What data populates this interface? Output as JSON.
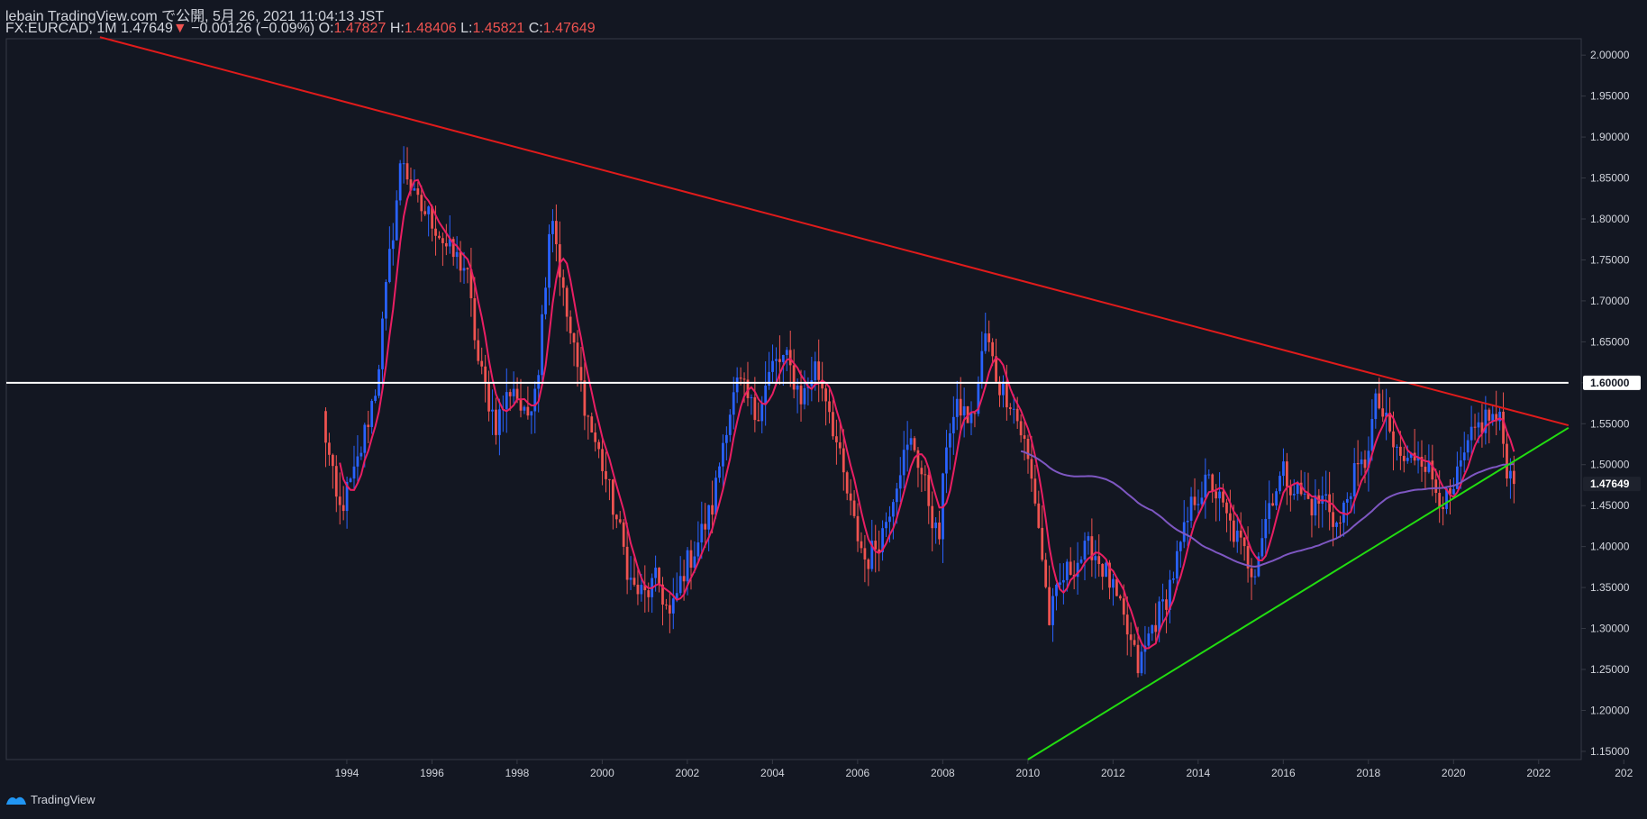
{
  "header": {
    "line1": "lebain TradingView.com で公開, 5月 26, 2021 11:04:13 JST",
    "symbol": "FX:EURCAD, 1M",
    "last": "1.47649",
    "change_arrow": "▼",
    "change": "−0.00126 (−0.09%)",
    "o_label": "O:",
    "o_val": "1.47827",
    "h_label": "H:",
    "h_val": "1.48406",
    "l_label": "L:",
    "l_val": "1.45821",
    "c_label": "C:",
    "c_val": "1.47649"
  },
  "footer": {
    "brand": "TradingView",
    "icon": "tradingview-logo-icon"
  },
  "colors": {
    "background": "#131722",
    "up": "#2962ff",
    "down": "#ef5350",
    "ma_fast": "#e91e63",
    "ma_slow": "#7e57c2",
    "resistance": "#e01b1b",
    "support": "#22dd11",
    "level": "#ffffff",
    "axis_text": "#d1d4dc"
  },
  "chart_data": {
    "type": "candlestick",
    "symbol": "FX:EURCAD",
    "interval": "1M",
    "xlabel": "",
    "ylabel": "",
    "ylim": [
      1.14,
      2.02
    ],
    "xlim": [
      1986.0,
      2023.0
    ],
    "x_ticks": [
      "1994",
      "1996",
      "1998",
      "2000",
      "2002",
      "2004",
      "2006",
      "2008",
      "2010",
      "2012",
      "2014",
      "2016",
      "2018",
      "2020",
      "2022",
      "202"
    ],
    "y_ticks": [
      "2.00000",
      "1.95000",
      "1.90000",
      "1.85000",
      "1.80000",
      "1.75000",
      "1.70000",
      "1.65000",
      "1.60000",
      "1.55000",
      "1.50000",
      "1.45000",
      "1.40000",
      "1.35000",
      "1.30000",
      "1.25000",
      "1.20000",
      "1.15000"
    ],
    "price_labels": [
      {
        "value": 1.6,
        "text": "1.60000",
        "style": "level"
      },
      {
        "value": 1.47649,
        "text": "1.47649",
        "style": "last"
      }
    ],
    "anchors": [
      [
        1993.42,
        1.56
      ],
      [
        1993.8,
        1.44
      ],
      [
        1994.2,
        1.49
      ],
      [
        1994.7,
        1.6
      ],
      [
        1995.0,
        1.75
      ],
      [
        1995.3,
        1.88
      ],
      [
        1995.6,
        1.82
      ],
      [
        1996.0,
        1.8
      ],
      [
        1996.4,
        1.76
      ],
      [
        1996.8,
        1.74
      ],
      [
        1997.1,
        1.62
      ],
      [
        1997.5,
        1.55
      ],
      [
        1997.9,
        1.6
      ],
      [
        1998.2,
        1.55
      ],
      [
        1998.5,
        1.62
      ],
      [
        1998.8,
        1.82
      ],
      [
        1999.1,
        1.7
      ],
      [
        1999.4,
        1.62
      ],
      [
        1999.7,
        1.55
      ],
      [
        2000.0,
        1.5
      ],
      [
        2000.4,
        1.42
      ],
      [
        2000.7,
        1.35
      ],
      [
        2001.0,
        1.34
      ],
      [
        2001.3,
        1.36
      ],
      [
        2001.6,
        1.31
      ],
      [
        2001.9,
        1.37
      ],
      [
        2002.2,
        1.4
      ],
      [
        2002.6,
        1.45
      ],
      [
        2002.9,
        1.55
      ],
      [
        2003.2,
        1.6
      ],
      [
        2003.6,
        1.56
      ],
      [
        2004.0,
        1.62
      ],
      [
        2004.3,
        1.63
      ],
      [
        2004.7,
        1.58
      ],
      [
        2005.0,
        1.62
      ],
      [
        2005.3,
        1.58
      ],
      [
        2005.6,
        1.5
      ],
      [
        2005.9,
        1.43
      ],
      [
        2006.2,
        1.38
      ],
      [
        2006.6,
        1.42
      ],
      [
        2007.0,
        1.5
      ],
      [
        2007.3,
        1.53
      ],
      [
        2007.7,
        1.45
      ],
      [
        2007.9,
        1.4
      ],
      [
        2008.1,
        1.54
      ],
      [
        2008.4,
        1.57
      ],
      [
        2008.7,
        1.55
      ],
      [
        2009.0,
        1.66
      ],
      [
        2009.3,
        1.6
      ],
      [
        2009.6,
        1.58
      ],
      [
        2009.9,
        1.53
      ],
      [
        2010.2,
        1.45
      ],
      [
        2010.5,
        1.31
      ],
      [
        2010.8,
        1.36
      ],
      [
        2011.1,
        1.38
      ],
      [
        2011.5,
        1.4
      ],
      [
        2011.9,
        1.36
      ],
      [
        2012.3,
        1.3
      ],
      [
        2012.6,
        1.25
      ],
      [
        2012.9,
        1.3
      ],
      [
        2013.2,
        1.33
      ],
      [
        2013.6,
        1.4
      ],
      [
        2013.9,
        1.46
      ],
      [
        2014.3,
        1.48
      ],
      [
        2014.7,
        1.43
      ],
      [
        2015.0,
        1.4
      ],
      [
        2015.3,
        1.37
      ],
      [
        2015.7,
        1.46
      ],
      [
        2016.0,
        1.49
      ],
      [
        2016.3,
        1.47
      ],
      [
        2016.7,
        1.45
      ],
      [
        2017.0,
        1.46
      ],
      [
        2017.3,
        1.42
      ],
      [
        2017.6,
        1.48
      ],
      [
        2017.9,
        1.5
      ],
      [
        2018.2,
        1.58
      ],
      [
        2018.6,
        1.52
      ],
      [
        2018.9,
        1.5
      ],
      [
        2019.2,
        1.52
      ],
      [
        2019.6,
        1.47
      ],
      [
        2019.9,
        1.45
      ],
      [
        2020.2,
        1.5
      ],
      [
        2020.5,
        1.54
      ],
      [
        2020.8,
        1.56
      ],
      [
        2021.1,
        1.55
      ],
      [
        2021.25,
        1.5
      ],
      [
        2021.4,
        1.47649
      ]
    ],
    "series": [
      {
        "name": "",
        "kind": "ma_fast"
      },
      {
        "name": "",
        "kind": "ma_slow",
        "start": 2009.8
      }
    ],
    "trendlines": [
      {
        "kind": "resistance",
        "from": [
          1988.2,
          2.022
        ],
        "to": [
          2022.7,
          1.548
        ]
      },
      {
        "kind": "support",
        "from": [
          2010.0,
          1.14
        ],
        "to": [
          2022.7,
          1.545
        ]
      },
      {
        "kind": "level",
        "from": [
          1986.0,
          1.6
        ],
        "to": [
          2022.7,
          1.6
        ]
      }
    ]
  }
}
